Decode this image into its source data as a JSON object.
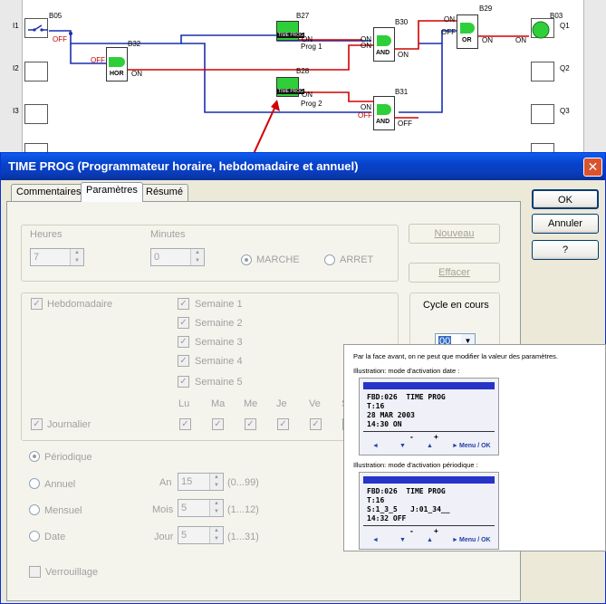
{
  "diagram": {
    "inputs": [
      "I1",
      "I2",
      "I3"
    ],
    "outputs": [
      "Q1",
      "Q2",
      "Q3"
    ],
    "blocks": {
      "b05": "B05",
      "b32": "B32",
      "b27": "B27",
      "b28": "B28",
      "b30": "B30",
      "b31": "B31",
      "b29": "B29",
      "b03": "B03"
    },
    "hor_label": "HOR",
    "and_label": "AND",
    "or_label": "OR",
    "prog1": "Prog 1",
    "prog2": "Prog 2",
    "state_on": "ON",
    "state_off": "OFF",
    "lcd_tag": "TIME PROG"
  },
  "dialog": {
    "title": "TIME PROG (Programmateur horaire, hebdomadaire et annuel)",
    "close_label": "✕",
    "tabs": [
      "Commentaires",
      "Paramètres",
      "Résumé"
    ],
    "buttons": {
      "ok": "OK",
      "cancel": "Annuler",
      "help": "?",
      "new": "Nouveau",
      "delete": "Effacer"
    },
    "time": {
      "hours_label": "Heures",
      "hours_value": "7",
      "minutes_label": "Minutes",
      "minutes_value": "0",
      "on_label": "MARCHE",
      "off_label": "ARRET"
    },
    "weekly": {
      "hebdo_label": "Hebdomadaire",
      "weeks": [
        "Semaine 1",
        "Semaine 2",
        "Semaine 3",
        "Semaine 4",
        "Semaine 5"
      ],
      "days": [
        "Lu",
        "Ma",
        "Me",
        "Je",
        "Ve",
        "S"
      ],
      "daily_label": "Journalier"
    },
    "cycle": {
      "label": "Cycle en cours",
      "value": "00"
    },
    "modes": {
      "periodic": "Périodique",
      "annual": "Annuel",
      "monthly": "Mensuel",
      "date": "Date"
    },
    "year": {
      "label": "An",
      "value": "15",
      "range": "(0...99)"
    },
    "month": {
      "label": "Mois",
      "value": "5",
      "range": "(1...12)"
    },
    "day": {
      "label": "Jour",
      "value": "5",
      "range": "(1...31)"
    },
    "lock_label": "Verrouillage"
  },
  "popup": {
    "intro": "Par la face avant, on ne peut que modifier la valeur des paramètres.",
    "date_caption": "Illustration: mode d'activation date :",
    "date_lines": [
      "FBD:026  TIME PROG",
      "T:16",
      "28 MAR 2003",
      "14:30 ON"
    ],
    "periodic_caption": "Illustration: mode d'activation périodique :",
    "periodic_lines": [
      "FBD:026  TIME PROG",
      "T:16",
      "S:1_3_5   J:01_34__",
      "14:32 OFF"
    ],
    "lcd_marks": [
      "-",
      "+"
    ],
    "lcd_nav": [
      "◄",
      "▼",
      "▲",
      "►",
      "Menu / OK"
    ]
  },
  "colors": {
    "titlebar": "#0a3ec0",
    "wire_red": "#d40000",
    "wire_blue": "#1a2fb0",
    "block_green": "#2fcf3a"
  }
}
